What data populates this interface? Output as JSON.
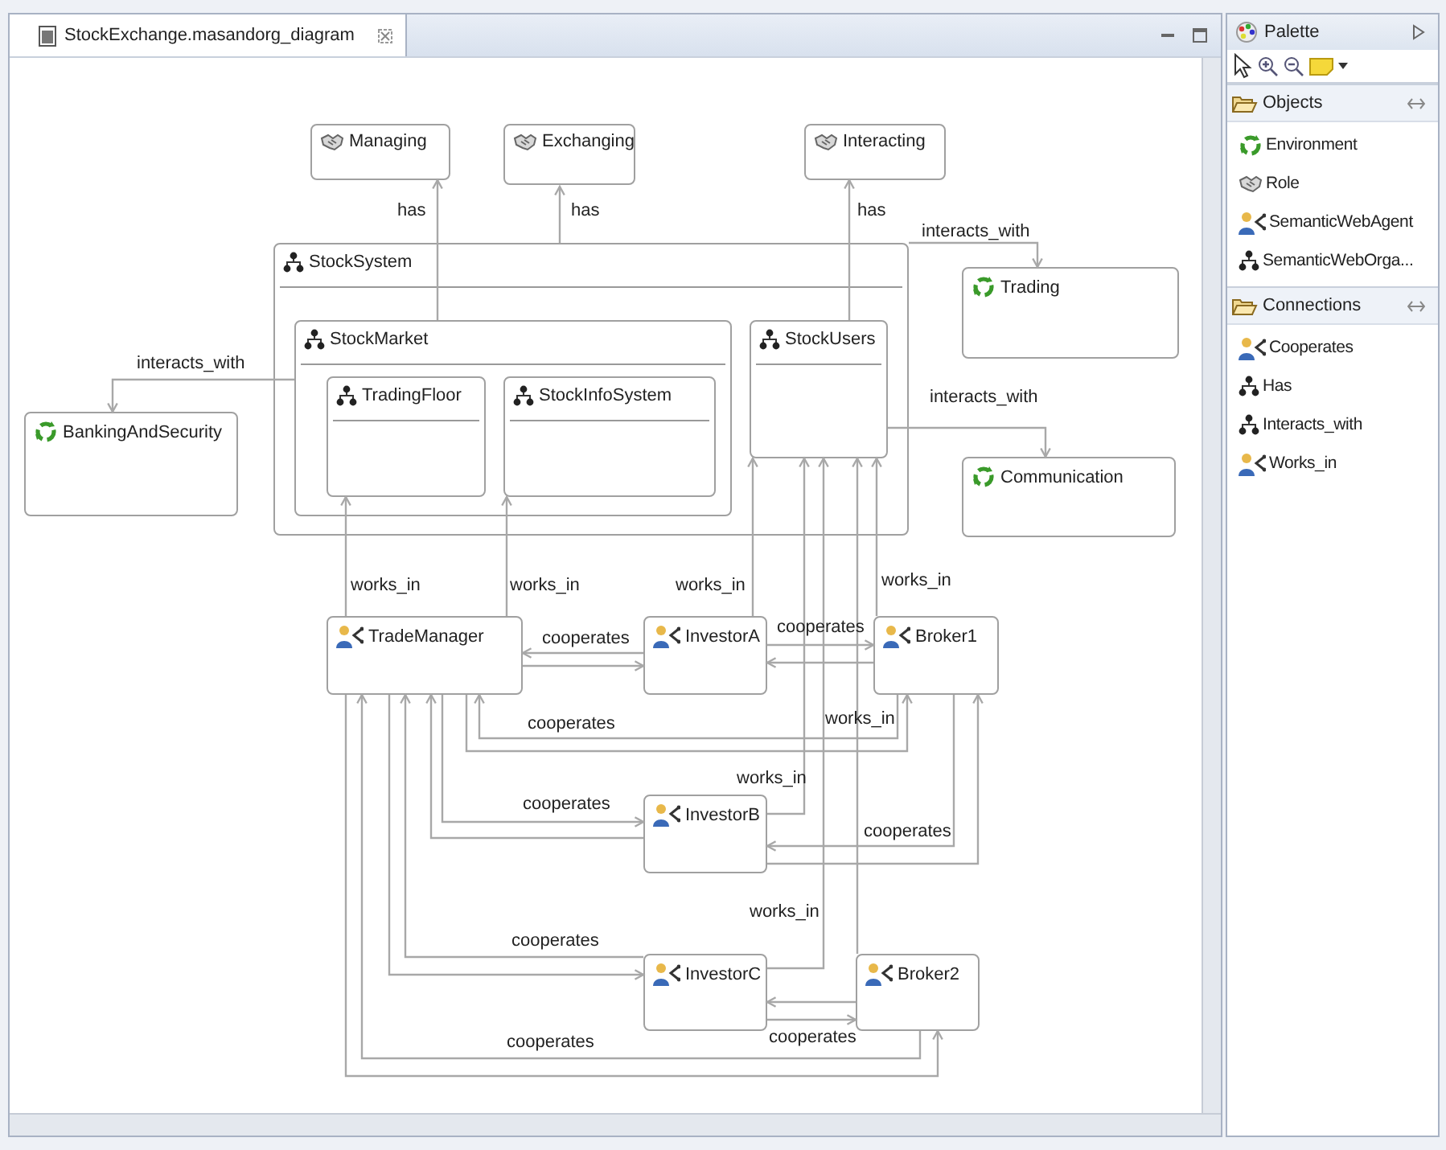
{
  "editor": {
    "tabs": [
      {
        "title": "StockExchange.masandorg_diagram",
        "selected": true
      }
    ]
  },
  "diagram": {
    "nodes": [
      {
        "kind": "role",
        "label": "Managing"
      },
      {
        "kind": "role",
        "label": "Exchanging"
      },
      {
        "kind": "role",
        "label": "Interacting"
      },
      {
        "kind": "organization",
        "label": "StockSystem",
        "children": [
          {
            "kind": "organization",
            "label": "StockMarket",
            "children": [
              {
                "kind": "organization",
                "label": "TradingFloor"
              },
              {
                "kind": "organization",
                "label": "StockInfoSystem"
              }
            ]
          },
          {
            "kind": "organization",
            "label": "StockUsers"
          }
        ]
      },
      {
        "kind": "environment",
        "label": "Trading"
      },
      {
        "kind": "environment",
        "label": "BankingAndSecurity"
      },
      {
        "kind": "environment",
        "label": "Communication"
      },
      {
        "kind": "agent",
        "label": "TradeManager"
      },
      {
        "kind": "agent",
        "label": "InvestorA"
      },
      {
        "kind": "agent",
        "label": "Broker1"
      },
      {
        "kind": "agent",
        "label": "InvestorB"
      },
      {
        "kind": "agent",
        "label": "InvestorC"
      },
      {
        "kind": "agent",
        "label": "Broker2"
      }
    ],
    "connections": [
      {
        "label": "has"
      },
      {
        "label": "has"
      },
      {
        "label": "has"
      },
      {
        "label": "interacts_with"
      },
      {
        "label": "interacts_with"
      },
      {
        "label": "interacts_with"
      },
      {
        "label": "works_in"
      },
      {
        "label": "works_in"
      },
      {
        "label": "works_in"
      },
      {
        "label": "works_in"
      },
      {
        "label": "works_in"
      },
      {
        "label": "works_in"
      },
      {
        "label": "works_in"
      },
      {
        "label": "cooperates"
      },
      {
        "label": "cooperates"
      },
      {
        "label": "cooperates"
      },
      {
        "label": "cooperates"
      },
      {
        "label": "cooperates"
      },
      {
        "label": "cooperates"
      },
      {
        "label": "cooperates"
      },
      {
        "label": "cooperates"
      }
    ]
  },
  "palette": {
    "title": "Palette",
    "drawers": [
      {
        "title": "Objects",
        "expanded": true,
        "items": [
          {
            "kind": "environment",
            "label": "Environment"
          },
          {
            "kind": "role",
            "label": "Role"
          },
          {
            "kind": "agent",
            "label": "SemanticWebAgent"
          },
          {
            "kind": "organization",
            "label": "SemanticWebOrga..."
          }
        ]
      },
      {
        "title": "Connections",
        "expanded": true,
        "items": [
          {
            "kind": "agent",
            "label": "Cooperates"
          },
          {
            "kind": "organization",
            "label": "Has"
          },
          {
            "kind": "organization",
            "label": "Interacts_with"
          },
          {
            "kind": "agent",
            "label": "Works_in"
          }
        ]
      }
    ]
  }
}
